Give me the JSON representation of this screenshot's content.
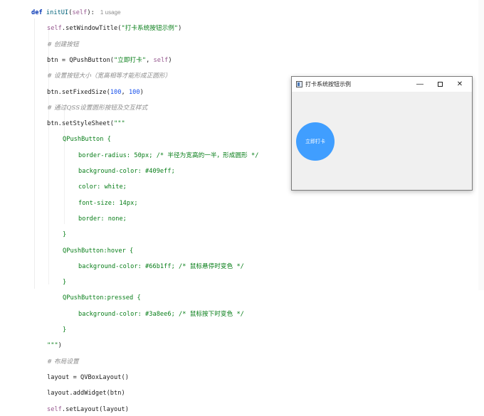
{
  "editor": {
    "lines": [
      {
        "parts": [
          [
            "kw",
            "def "
          ],
          [
            "fn",
            "initUI"
          ],
          [
            "",
            "("
          ],
          [
            "self",
            "self"
          ],
          [
            "",
            "):"
          ]
        ],
        "usage": "1 usage"
      },
      {
        "parts": [
          [
            "self",
            "self"
          ],
          [
            "",
            ".setWindowTitle("
          ],
          [
            "str",
            "\"打卡系统按钮示例\""
          ],
          [
            "",
            ")"
          ]
        ]
      },
      {
        "parts": [
          [
            "cmt",
            "# 创建按钮"
          ]
        ]
      },
      {
        "parts": [
          [
            "",
            "btn = QPushButton("
          ],
          [
            "str",
            "\"立即打卡\""
          ],
          [
            "",
            ", "
          ],
          [
            "self",
            "self"
          ],
          [
            "",
            ")"
          ]
        ]
      },
      {
        "parts": [
          [
            "cmt",
            "# 设置按钮大小（宽高相等才能形成正圆形）"
          ]
        ]
      },
      {
        "parts": [
          [
            "",
            "btn.setFixedSize("
          ],
          [
            "num",
            "100"
          ],
          [
            "",
            ", "
          ],
          [
            "num",
            "100"
          ],
          [
            "",
            ")"
          ]
        ]
      },
      {
        "parts": [
          [
            "cmt",
            "# 通过QSS设置圆形按钮及交互样式"
          ]
        ]
      },
      {
        "parts": [
          [
            "",
            "btn.setStyleSheet("
          ],
          [
            "str",
            "\"\"\""
          ]
        ]
      },
      {
        "parts": [
          [
            "css",
            "QPushButton {"
          ]
        ]
      },
      {
        "parts": [
          [
            "css",
            "border-radius: 50px; /* 半径为宽高的一半，形成圆形 */"
          ]
        ]
      },
      {
        "parts": [
          [
            "css",
            "background-color: #409eff;"
          ]
        ]
      },
      {
        "parts": [
          [
            "css",
            "color: white;"
          ]
        ]
      },
      {
        "parts": [
          [
            "css",
            "font-size: 14px;"
          ]
        ]
      },
      {
        "parts": [
          [
            "css",
            "border: none;"
          ]
        ]
      },
      {
        "parts": [
          [
            "css",
            "}"
          ]
        ]
      },
      {
        "parts": [
          [
            "css",
            "QPushButton:hover {"
          ]
        ]
      },
      {
        "parts": [
          [
            "css",
            "background-color: #66b1ff; /* 鼠标悬停时变色 */"
          ]
        ]
      },
      {
        "parts": [
          [
            "css",
            "}"
          ]
        ]
      },
      {
        "parts": [
          [
            "css",
            "QPushButton:pressed {"
          ]
        ]
      },
      {
        "parts": [
          [
            "css",
            "background-color: #3a8ee6; /* 鼠标按下时变色 */"
          ]
        ]
      },
      {
        "parts": [
          [
            "css",
            "}"
          ]
        ]
      },
      {
        "parts": [
          [
            "str",
            "\"\"\""
          ],
          [
            "",
            ")"
          ]
        ]
      },
      {
        "parts": [
          [
            "cmt",
            "# 布局设置"
          ]
        ]
      },
      {
        "parts": [
          [
            "",
            "layout = QVBoxLayout()"
          ]
        ]
      },
      {
        "parts": [
          [
            "",
            "layout.addWidget(btn)"
          ]
        ]
      },
      {
        "parts": [
          [
            "self",
            "self"
          ],
          [
            "",
            ".setLayout(layout)"
          ]
        ]
      }
    ]
  },
  "window": {
    "title": "打卡系统按钮示例",
    "minimize_glyph": "—",
    "close_glyph": "✕",
    "button_label": "立即打卡",
    "button_color": "#409eff"
  }
}
